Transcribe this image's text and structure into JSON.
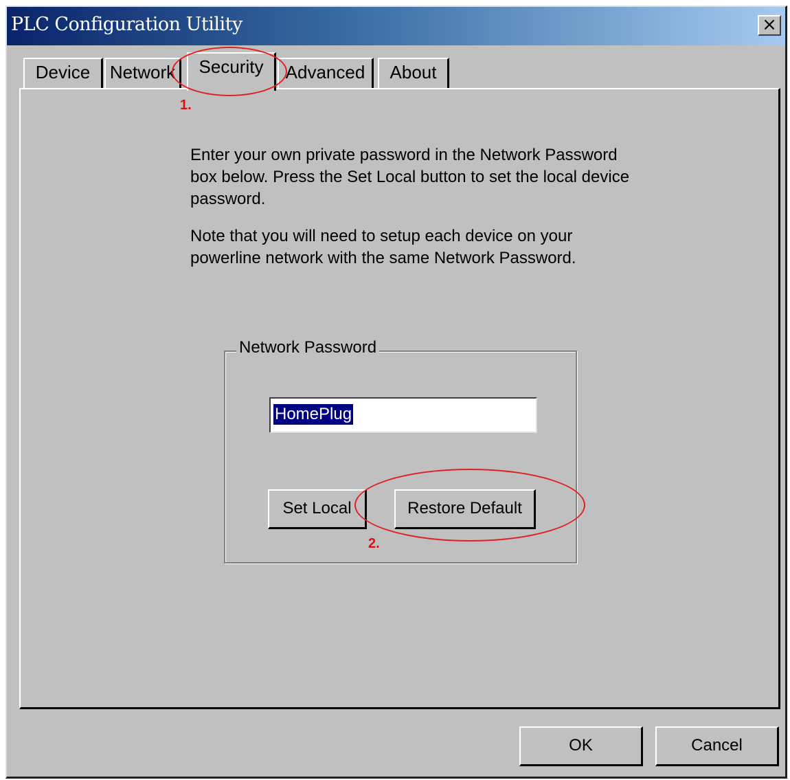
{
  "window": {
    "title": "PLC Configuration Utility",
    "close_glyph": "×"
  },
  "tabs": [
    {
      "label": "Device",
      "active": false
    },
    {
      "label": "Network",
      "active": false
    },
    {
      "label": "Security",
      "active": true
    },
    {
      "label": "Advanced",
      "active": false
    },
    {
      "label": "About",
      "active": false
    }
  ],
  "security": {
    "instruction_1": "Enter your own private password in the Network Password box below. Press the Set Local button to set the local device password.",
    "instruction_2": "Note that you will need to setup each device on your powerline network with the same Network Password.",
    "group_label": "Network Password",
    "password_value": "HomePlug",
    "set_local_label": "Set Local",
    "restore_default_label": "Restore Default"
  },
  "footer": {
    "ok_label": "OK",
    "cancel_label": "Cancel"
  },
  "annotations": {
    "step1": "1.",
    "step2": "2.",
    "color": "#e02020"
  }
}
